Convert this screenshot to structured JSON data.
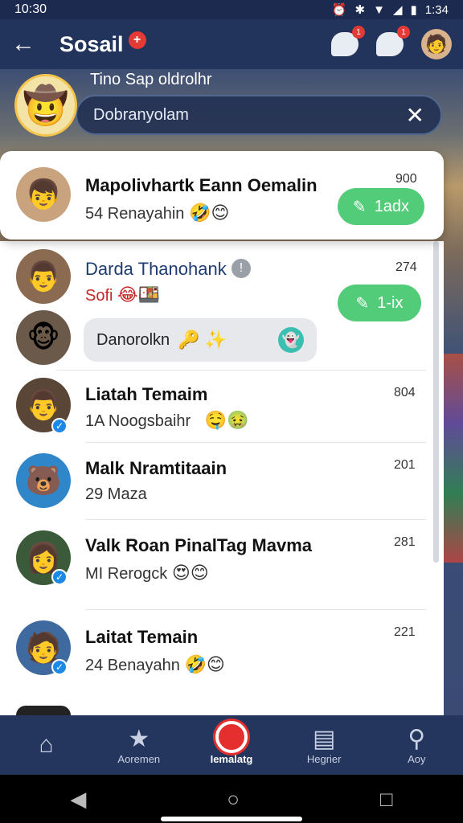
{
  "status_bar": {
    "time": "10:30",
    "time_right": "1:34",
    "icons": [
      "alarm-icon",
      "bluetooth-icon",
      "wifi-icon",
      "signal-icon",
      "battery-icon"
    ]
  },
  "app_bar": {
    "title": "Sosail",
    "title_badge": "+",
    "badge_1": "1",
    "badge_2": "1"
  },
  "header": {
    "caption": "Tino Sap oldrolhr",
    "search_placeholder": "Dobranyolam"
  },
  "chats": [
    {
      "name": "Mapolivhartk Eann Oemalin",
      "preview": "54 Renayahin",
      "emojis": "🤣😊",
      "time": "900",
      "action": "1adx"
    },
    {
      "name": "Darda Thanohank",
      "preview": "Sofi",
      "emojis": "😂🍱",
      "time": "274",
      "action": "1-ix"
    },
    {
      "bubble_text": "Danorolkn",
      "bubble_emojis": "🔑 ✨"
    },
    {
      "name": "Liatah Temaim",
      "preview": "1A Noogsbaihr",
      "emojis": "🤤🤢",
      "time": "804"
    },
    {
      "name": "Malk Nramtitaain",
      "preview": "29 Maza",
      "time": "201"
    },
    {
      "name": "Valk Roan PinalTag Mavma",
      "preview": "MI Rerogck",
      "emojis": "😍😊",
      "time": "281"
    },
    {
      "name": "Laitat Temain",
      "preview": "24 Benayahn",
      "emojis": "🤣😊",
      "time": "221"
    }
  ],
  "bottom_nav": [
    {
      "label": "",
      "icon": "home-icon"
    },
    {
      "label": "Aoremen",
      "icon": "star-icon"
    },
    {
      "label": "Iemalatg",
      "icon": "record-icon",
      "active": true
    },
    {
      "label": "Hegrier",
      "icon": "photo-icon"
    },
    {
      "label": "Aoy",
      "icon": "search-icon"
    }
  ],
  "colors": {
    "app_bar": "#22335c",
    "accent_green": "#52cc78",
    "badge_red": "#e53935"
  }
}
